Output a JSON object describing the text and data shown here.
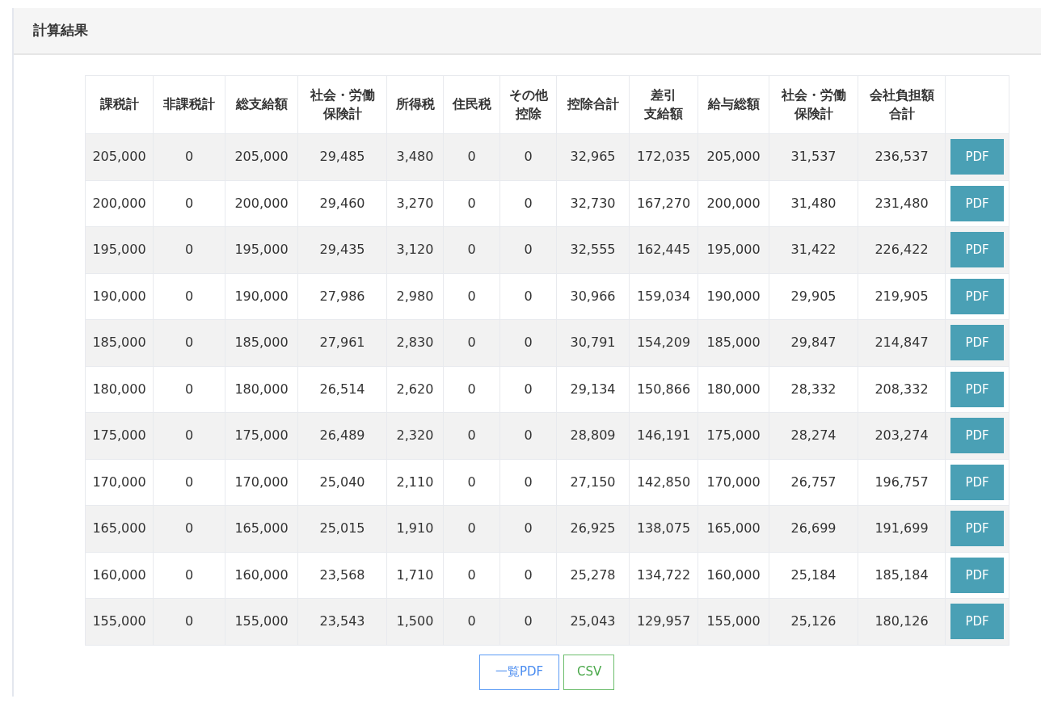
{
  "panel": {
    "title": "計算結果"
  },
  "table": {
    "columns": [
      {
        "lines": [
          "課税計"
        ]
      },
      {
        "lines": [
          "非課税計"
        ]
      },
      {
        "lines": [
          "総支給額"
        ]
      },
      {
        "lines": [
          "社会・労働",
          "保険計"
        ]
      },
      {
        "lines": [
          "所得税"
        ]
      },
      {
        "lines": [
          "住民税"
        ]
      },
      {
        "lines": [
          "その他",
          "控除"
        ]
      },
      {
        "lines": [
          "控除合計"
        ]
      },
      {
        "lines": [
          "差引",
          "支給額"
        ]
      },
      {
        "lines": [
          "給与総額"
        ]
      },
      {
        "lines": [
          "社会・労働",
          "保険計"
        ]
      },
      {
        "lines": [
          "会社負担額",
          "合計"
        ]
      }
    ],
    "rows": [
      {
        "cells": [
          "205,000",
          "0",
          "205,000",
          "29,485",
          "3,480",
          "0",
          "0",
          "32,965",
          "172,035",
          "205,000",
          "31,537",
          "236,537"
        ],
        "button": "PDF"
      },
      {
        "cells": [
          "200,000",
          "0",
          "200,000",
          "29,460",
          "3,270",
          "0",
          "0",
          "32,730",
          "167,270",
          "200,000",
          "31,480",
          "231,480"
        ],
        "button": "PDF"
      },
      {
        "cells": [
          "195,000",
          "0",
          "195,000",
          "29,435",
          "3,120",
          "0",
          "0",
          "32,555",
          "162,445",
          "195,000",
          "31,422",
          "226,422"
        ],
        "button": "PDF"
      },
      {
        "cells": [
          "190,000",
          "0",
          "190,000",
          "27,986",
          "2,980",
          "0",
          "0",
          "30,966",
          "159,034",
          "190,000",
          "29,905",
          "219,905"
        ],
        "button": "PDF"
      },
      {
        "cells": [
          "185,000",
          "0",
          "185,000",
          "27,961",
          "2,830",
          "0",
          "0",
          "30,791",
          "154,209",
          "185,000",
          "29,847",
          "214,847"
        ],
        "button": "PDF"
      },
      {
        "cells": [
          "180,000",
          "0",
          "180,000",
          "26,514",
          "2,620",
          "0",
          "0",
          "29,134",
          "150,866",
          "180,000",
          "28,332",
          "208,332"
        ],
        "button": "PDF"
      },
      {
        "cells": [
          "175,000",
          "0",
          "175,000",
          "26,489",
          "2,320",
          "0",
          "0",
          "28,809",
          "146,191",
          "175,000",
          "28,274",
          "203,274"
        ],
        "button": "PDF"
      },
      {
        "cells": [
          "170,000",
          "0",
          "170,000",
          "25,040",
          "2,110",
          "0",
          "0",
          "27,150",
          "142,850",
          "170,000",
          "26,757",
          "196,757"
        ],
        "button": "PDF"
      },
      {
        "cells": [
          "165,000",
          "0",
          "165,000",
          "25,015",
          "1,910",
          "0",
          "0",
          "26,925",
          "138,075",
          "165,000",
          "26,699",
          "191,699"
        ],
        "button": "PDF"
      },
      {
        "cells": [
          "160,000",
          "0",
          "160,000",
          "23,568",
          "1,710",
          "0",
          "0",
          "25,278",
          "134,722",
          "160,000",
          "25,184",
          "185,184"
        ],
        "button": "PDF"
      },
      {
        "cells": [
          "155,000",
          "0",
          "155,000",
          "23,543",
          "1,500",
          "0",
          "0",
          "25,043",
          "129,957",
          "155,000",
          "25,126",
          "180,126"
        ],
        "button": "PDF"
      }
    ]
  },
  "actions": [
    {
      "label": "一覧PDF",
      "kind": "primary"
    },
    {
      "label": "CSV",
      "kind": "success"
    }
  ]
}
